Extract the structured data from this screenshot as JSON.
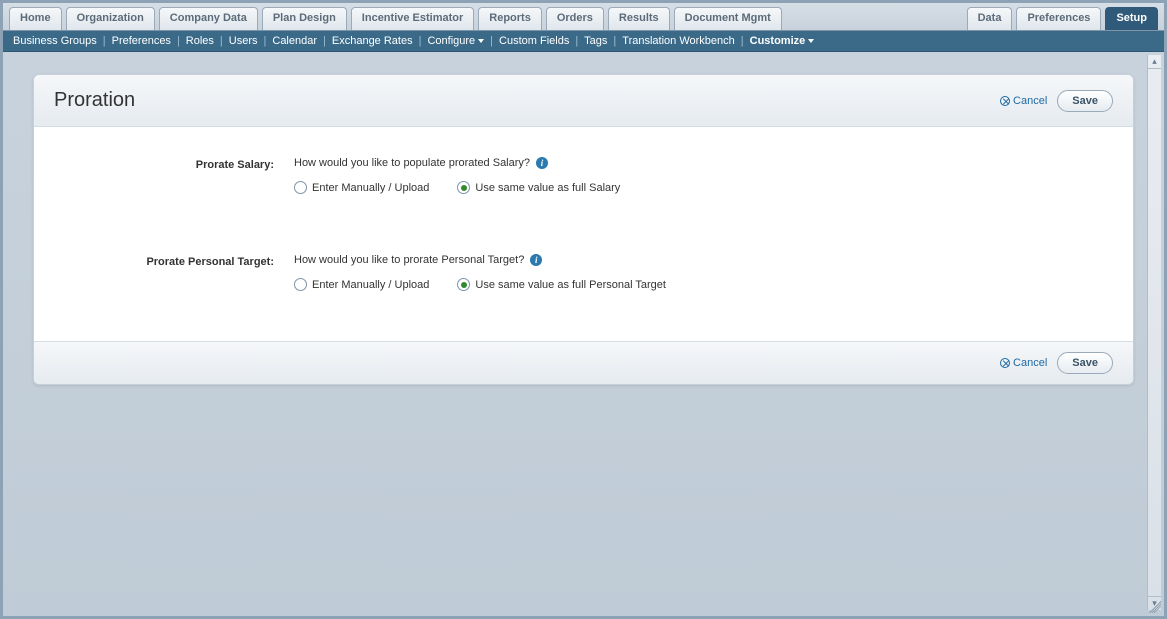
{
  "topTabs": {
    "left": [
      "Home",
      "Organization",
      "Company Data",
      "Plan Design",
      "Incentive Estimator",
      "Reports",
      "Orders",
      "Results",
      "Document Mgmt"
    ],
    "right": [
      "Data",
      "Preferences",
      "Setup"
    ],
    "activeRight": "Setup"
  },
  "subnav": {
    "items": [
      {
        "label": "Business Groups"
      },
      {
        "label": "Preferences"
      },
      {
        "label": "Roles"
      },
      {
        "label": "Users"
      },
      {
        "label": "Calendar"
      },
      {
        "label": "Exchange Rates"
      },
      {
        "label": "Configure",
        "dropdown": true
      },
      {
        "label": "Custom Fields"
      },
      {
        "label": "Tags"
      },
      {
        "label": "Translation Workbench"
      },
      {
        "label": "Customize",
        "dropdown": true,
        "active": true
      }
    ]
  },
  "panel": {
    "title": "Proration",
    "cancel": "Cancel",
    "save": "Save"
  },
  "fields": {
    "prorateSalary": {
      "label": "Prorate Salary:",
      "question": "How would you like to populate prorated Salary?",
      "opt1": "Enter Manually / Upload",
      "opt2": "Use same value as full Salary",
      "selected": "opt2"
    },
    "proratePersonalTarget": {
      "label": "Prorate Personal Target:",
      "question": "How would you like to prorate Personal Target?",
      "opt1": "Enter Manually / Upload",
      "opt2": "Use same value as full Personal Target",
      "selected": "opt2"
    }
  }
}
